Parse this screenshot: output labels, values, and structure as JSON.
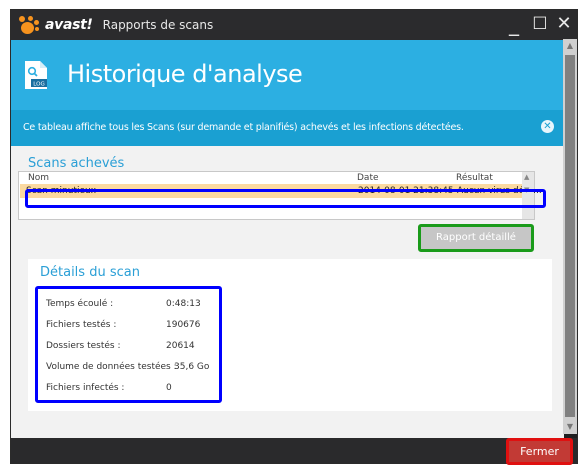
{
  "window": {
    "brand": "avast!",
    "title": "Rapports de scans",
    "controls": {
      "minimize": "_",
      "maximize": "☐",
      "close": "✕"
    }
  },
  "banner": {
    "icon_label": "LOG",
    "title": "Historique d'analyse"
  },
  "info": {
    "text": "Ce tableau affiche tous les Scans (sur demande et planifiés) achevés et les infections détectées.",
    "close_glyph": "✕"
  },
  "scans": {
    "section_title": "Scans achevés",
    "columns": {
      "name": "Nom",
      "date": "Date",
      "result": "Résultat"
    },
    "rows": [
      {
        "name": "Scan minutieux",
        "date": "2014-08-01 21:38:45",
        "result": "Aucun virus déte..."
      }
    ]
  },
  "report_button": "Rapport détaillé",
  "details": {
    "section_title": "Détails du scan",
    "rows": [
      {
        "label": "Temps écoulé :",
        "value": "0:48:13"
      },
      {
        "label": "Fichiers testés :",
        "value": "190676"
      },
      {
        "label": "Dossiers testés :",
        "value": "20614"
      },
      {
        "label": "Volume de données testées :",
        "value": "35,6 Go"
      },
      {
        "label": "Fichiers infectés :",
        "value": "0"
      }
    ]
  },
  "close_button": "Fermer",
  "colors": {
    "accent_blue": "#2cafe2",
    "brand_orange": "#f7931e",
    "row_highlight": "#fbd9a0",
    "close_red": "#c23a35",
    "annotation_blue": "#0000ff",
    "annotation_green": "#1a9b1a",
    "annotation_red": "#e01010"
  }
}
